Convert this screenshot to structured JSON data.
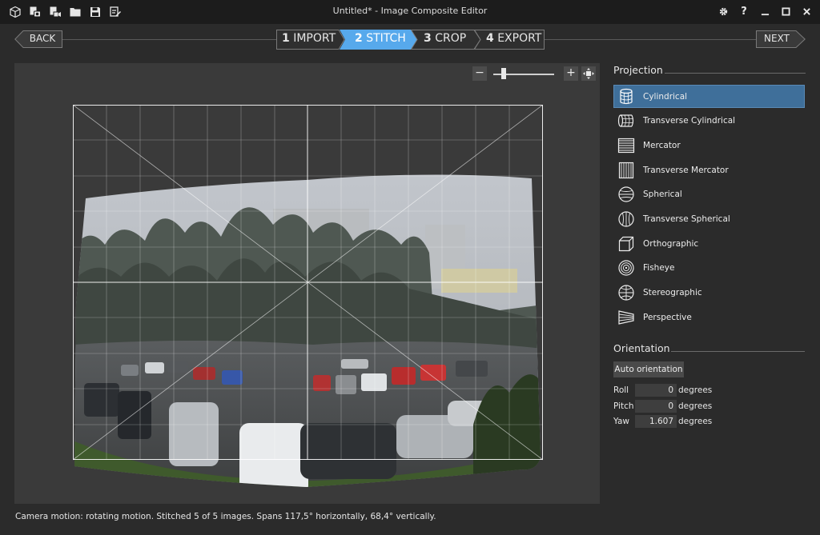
{
  "window": {
    "title": "Untitled* - Image Composite Editor",
    "toolbar_icons": [
      "new-panorama-icon",
      "new-from-images-icon",
      "new-from-video-icon",
      "open-project-icon",
      "save-project-icon",
      "export-icon"
    ],
    "controls": [
      "settings-icon",
      "help-icon",
      "minimize-icon",
      "maximize-icon",
      "close-icon"
    ],
    "help_glyph": "?"
  },
  "nav": {
    "back_label": "BACK",
    "next_label": "NEXT",
    "steps": [
      {
        "num": "1",
        "label": "IMPORT",
        "active": false
      },
      {
        "num": "2",
        "label": "STITCH",
        "active": true
      },
      {
        "num": "3",
        "label": "CROP",
        "active": false
      },
      {
        "num": "4",
        "label": "EXPORT",
        "active": false
      }
    ],
    "accent": "#57a9ec"
  },
  "zoom": {
    "minus": "−",
    "plus": "+",
    "fit_icon": "fit-to-window-icon",
    "level_fraction": 0.05
  },
  "projection": {
    "title": "Projection",
    "items": [
      {
        "label": "Cylindrical",
        "icon": "cylindrical-icon",
        "selected": true
      },
      {
        "label": "Transverse Cylindrical",
        "icon": "transverse-cylindrical-icon",
        "selected": false
      },
      {
        "label": "Mercator",
        "icon": "mercator-icon",
        "selected": false
      },
      {
        "label": "Transverse Mercator",
        "icon": "transverse-mercator-icon",
        "selected": false
      },
      {
        "label": "Spherical",
        "icon": "spherical-icon",
        "selected": false
      },
      {
        "label": "Transverse Spherical",
        "icon": "transverse-spherical-icon",
        "selected": false
      },
      {
        "label": "Orthographic",
        "icon": "orthographic-icon",
        "selected": false
      },
      {
        "label": "Fisheye",
        "icon": "fisheye-icon",
        "selected": false
      },
      {
        "label": "Stereographic",
        "icon": "stereographic-icon",
        "selected": false
      },
      {
        "label": "Perspective",
        "icon": "perspective-icon",
        "selected": false
      }
    ]
  },
  "orientation": {
    "title": "Orientation",
    "auto_label": "Auto orientation",
    "rows": [
      {
        "name": "Roll",
        "value": "0",
        "unit": "degrees"
      },
      {
        "name": "Pitch",
        "value": "0",
        "unit": "degrees"
      },
      {
        "name": "Yaw",
        "value": "1.607",
        "unit": "degrees"
      }
    ]
  },
  "status": "Camera motion: rotating motion. Stitched 5 of 5 images. Spans 117,5° horizontally, 68,4° vertically."
}
